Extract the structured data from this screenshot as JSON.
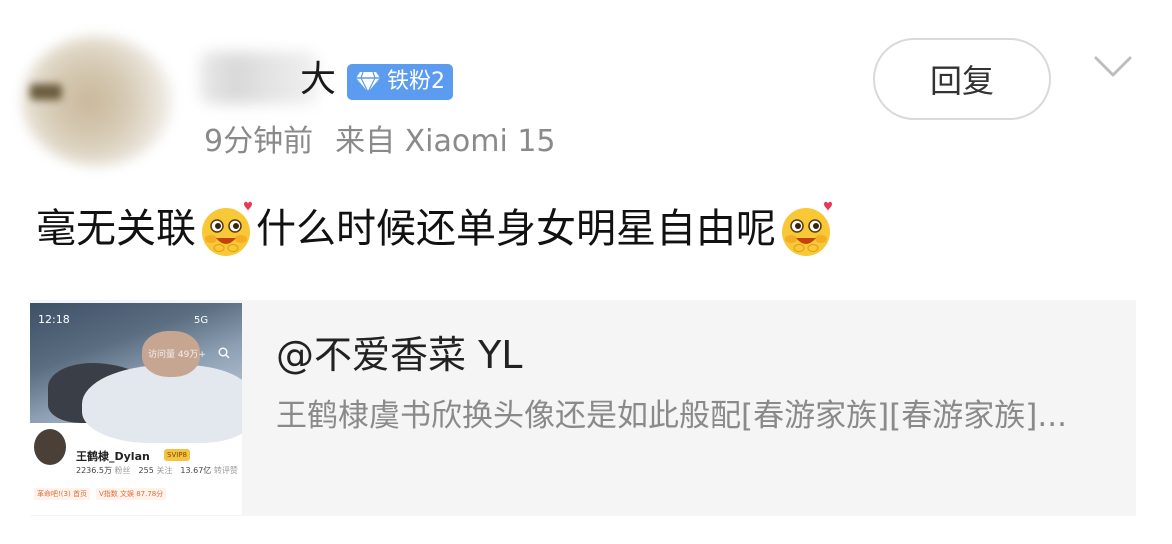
{
  "comment": {
    "username_suffix": "大",
    "fan_badge": "铁粉2",
    "time": "9分钟前",
    "source": "来自 Xiaomi 15",
    "reply_button": "回复",
    "content_parts": [
      "毫无关联",
      "什么时候还单身女明星自由呢"
    ]
  },
  "repost": {
    "author": "@不爱香菜 YL",
    "text": "王鹤棣虞书欣换头像还是如此般配[春游家族][春游家族]...",
    "thumbnail": {
      "time": "12:18",
      "signal": "5G",
      "visits": "访问量 49万+",
      "profile_name": "王鹤棣_Dylan",
      "svip": "SVIP8",
      "followers_value": "2236.5万",
      "followers_label": "粉丝",
      "following_value": "255",
      "following_label": "关注",
      "likes_value": "13.67亿",
      "likes_label": "转评赞",
      "tag_1": "革命吧!(3) 首页",
      "tag_2": "V指数 文娱 87.78分"
    }
  },
  "colors": {
    "badge_blue": "#5b9bf0",
    "meta_gray": "#8a8a8a",
    "repost_bg": "#f5f5f5"
  },
  "icons": [
    "diamond-icon",
    "chevron-down-icon",
    "blush-emoji-icon"
  ]
}
